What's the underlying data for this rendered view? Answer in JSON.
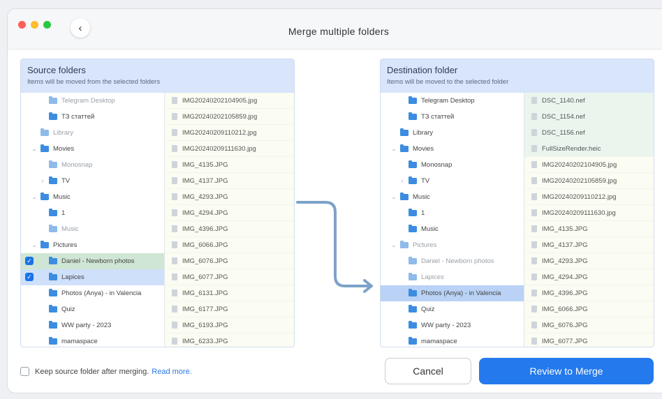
{
  "window": {
    "title": "Merge multiple folders"
  },
  "source": {
    "title": "Source folders",
    "subtitle": "Items will be moved from the selected folders",
    "folders": [
      {
        "label": "Telegram Desktop",
        "indent": 2,
        "dim": true
      },
      {
        "label": "ТЗ статтей",
        "indent": 2,
        "dim": false
      },
      {
        "label": "Library",
        "indent": 1,
        "dim": true
      },
      {
        "label": "Movies",
        "indent": 1,
        "dim": false,
        "chevron": "down"
      },
      {
        "label": "Monosnap",
        "indent": 2,
        "dim": true
      },
      {
        "label": "TV",
        "indent": 2,
        "dim": false,
        "chevron": "right"
      },
      {
        "label": "Music",
        "indent": 1,
        "dim": false,
        "chevron": "down"
      },
      {
        "label": "1",
        "indent": 2,
        "dim": false
      },
      {
        "label": "Music",
        "indent": 2,
        "dim": true
      },
      {
        "label": "Pictures",
        "indent": 1,
        "dim": false,
        "chevron": "down"
      },
      {
        "label": "Daniel - Newborn photos",
        "indent": 2,
        "dim": false,
        "checked": true,
        "sel": "green"
      },
      {
        "label": "Lapices",
        "indent": 2,
        "dim": false,
        "checked": true,
        "sel": "blue"
      },
      {
        "label": "Photos (Anya) - in Valencia",
        "indent": 2,
        "dim": false
      },
      {
        "label": "Quiz",
        "indent": 2,
        "dim": false
      },
      {
        "label": "WW party - 2023",
        "indent": 2,
        "dim": false
      },
      {
        "label": "mamaspace",
        "indent": 2,
        "dim": false
      }
    ],
    "files": [
      "IMG20240202104905.jpg",
      "IMG20240202105859.jpg",
      "IMG20240209110212.jpg",
      "IMG20240209111630.jpg",
      "IMG_4135.JPG",
      "IMG_4137.JPG",
      "IMG_4293.JPG",
      "IMG_4294.JPG",
      "IMG_4396.JPG",
      "IMG_6066.JPG",
      "IMG_6076.JPG",
      "IMG_6077.JPG",
      "IMG_6131.JPG",
      "IMG_6177.JPG",
      "IMG_6193.JPG",
      "IMG_6233.JPG"
    ]
  },
  "destination": {
    "title": "Destination folder",
    "subtitle": "Items will be moved to the selected folder",
    "folders": [
      {
        "label": "Telegram Desktop",
        "indent": 2,
        "dim": false
      },
      {
        "label": "ТЗ статтей",
        "indent": 2,
        "dim": false
      },
      {
        "label": "Library",
        "indent": 1,
        "dim": false
      },
      {
        "label": "Movies",
        "indent": 1,
        "dim": false,
        "chevron": "down"
      },
      {
        "label": "Monosnap",
        "indent": 2,
        "dim": false
      },
      {
        "label": "TV",
        "indent": 2,
        "dim": false,
        "chevron": "right"
      },
      {
        "label": "Music",
        "indent": 1,
        "dim": false,
        "chevron": "down"
      },
      {
        "label": "1",
        "indent": 2,
        "dim": false
      },
      {
        "label": "Music",
        "indent": 2,
        "dim": false
      },
      {
        "label": "Pictures",
        "indent": 1,
        "dim": true,
        "chevron": "down"
      },
      {
        "label": "Daniel - Newborn photos",
        "indent": 2,
        "dim": true
      },
      {
        "label": "Lapices",
        "indent": 2,
        "dim": true
      },
      {
        "label": "Photos (Anya) - in Valencia",
        "indent": 2,
        "dim": false,
        "highlight": true
      },
      {
        "label": "Quiz",
        "indent": 2,
        "dim": false
      },
      {
        "label": "WW party - 2023",
        "indent": 2,
        "dim": false
      },
      {
        "label": "mamaspace",
        "indent": 2,
        "dim": false
      }
    ],
    "files": [
      {
        "name": "DSC_1140.nef",
        "green": true
      },
      {
        "name": "DSC_1154.nef",
        "green": true
      },
      {
        "name": "DSC_1156.nef",
        "green": true
      },
      {
        "name": "FullSizeRender.heic",
        "green": true
      },
      {
        "name": "IMG20240202104905.jpg",
        "green": false
      },
      {
        "name": "IMG20240202105859.jpg",
        "green": false
      },
      {
        "name": "IMG20240209110212.jpg",
        "green": false
      },
      {
        "name": "IMG20240209111630.jpg",
        "green": false
      },
      {
        "name": "IMG_4135.JPG",
        "green": false
      },
      {
        "name": "IMG_4137.JPG",
        "green": false
      },
      {
        "name": "IMG_4293.JPG",
        "green": false
      },
      {
        "name": "IMG_4294.JPG",
        "green": false
      },
      {
        "name": "IMG_4396.JPG",
        "green": false
      },
      {
        "name": "IMG_6066.JPG",
        "green": false
      },
      {
        "name": "IMG_6076.JPG",
        "green": false
      },
      {
        "name": "IMG_6077.JPG",
        "green": false
      }
    ]
  },
  "footer": {
    "keep_label": "Keep source folder after merging.",
    "read_more": "Read more.",
    "cancel_label": "Cancel",
    "review_label": "Review to Merge"
  },
  "colors": {
    "accent": "#2479ec",
    "panel_header": "#d8e5fb",
    "arrow": "#7da2c9"
  },
  "icons": {
    "back": "chevron-left-icon",
    "folder": "folder-icon",
    "file": "file-icon",
    "checkbox": "checkbox-icon"
  }
}
